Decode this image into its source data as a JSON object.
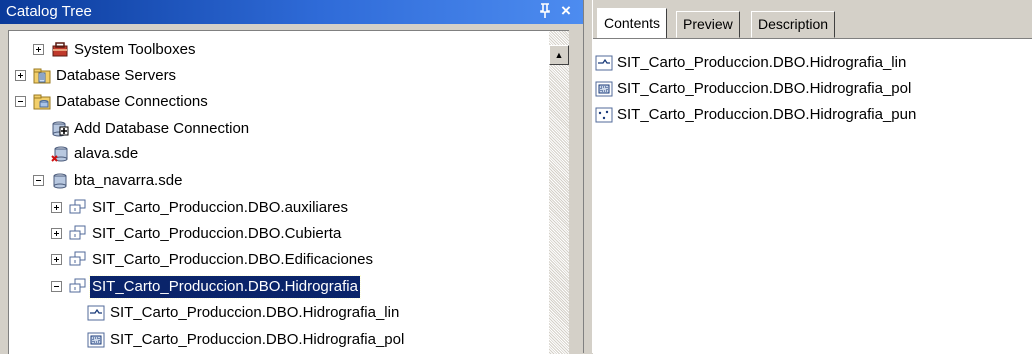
{
  "catalog": {
    "title": "Catalog Tree",
    "pin_glyph": "ᵽ",
    "close_glyph": "×",
    "tree": [
      {
        "label": "System Toolboxes",
        "expander": "plus",
        "icon": "toolbox-icon"
      },
      {
        "label": "Database Servers",
        "expander": "plus",
        "icon": "database-server-icon"
      },
      {
        "label": "Database Connections",
        "expander": "minus",
        "icon": "folder-database-icon"
      },
      {
        "label": "Add Database Connection",
        "expander": "none",
        "icon": "add-connection-icon"
      },
      {
        "label": "alava.sde",
        "expander": "none",
        "icon": "broken-connection-icon"
      },
      {
        "label": "bta_navarra.sde",
        "expander": "minus",
        "icon": "database-connection-icon"
      },
      {
        "label": "SIT_Carto_Produccion.DBO.auxiliares",
        "expander": "plus",
        "icon": "feature-dataset-icon"
      },
      {
        "label": "SIT_Carto_Produccion.DBO.Cubierta",
        "expander": "plus",
        "icon": "feature-dataset-icon"
      },
      {
        "label": "SIT_Carto_Produccion.DBO.Edificaciones",
        "expander": "plus",
        "icon": "feature-dataset-icon"
      },
      {
        "label": "SIT_Carto_Produccion.DBO.Hidrografia",
        "expander": "minus",
        "icon": "feature-dataset-icon",
        "selected": true
      },
      {
        "label": "SIT_Carto_Produccion.DBO.Hidrografia_lin",
        "expander": "none",
        "icon": "line-feature-class-icon"
      },
      {
        "label": "SIT_Carto_Produccion.DBO.Hidrografia_pol",
        "expander": "none",
        "icon": "polygon-feature-class-icon"
      }
    ]
  },
  "content": {
    "tabs": [
      {
        "label": "Contents",
        "active": true
      },
      {
        "label": "Preview",
        "active": false
      },
      {
        "label": "Description",
        "active": false
      }
    ],
    "items": [
      {
        "label": "SIT_Carto_Produccion.DBO.Hidrografia_lin",
        "icon": "line-feature-class-icon"
      },
      {
        "label": "SIT_Carto_Produccion.DBO.Hidrografia_pol",
        "icon": "polygon-feature-class-icon"
      },
      {
        "label": "SIT_Carto_Produccion.DBO.Hidrografia_pun",
        "icon": "point-feature-class-icon"
      }
    ]
  },
  "colors": {
    "selection_bg": "#0a246a",
    "title_bar": "#0a3a9a",
    "panel_bg": "#d4d0c8"
  }
}
